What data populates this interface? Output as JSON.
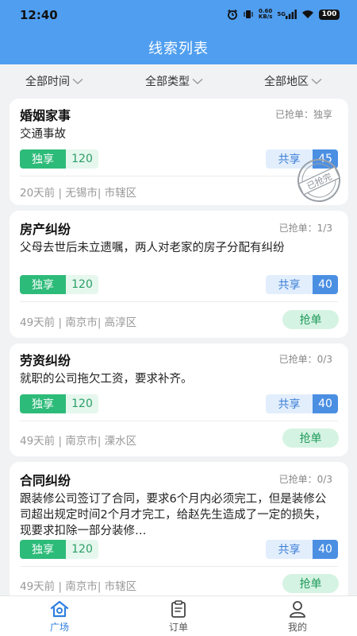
{
  "status_bar": {
    "time": "12:40",
    "speed_value": "0.60",
    "speed_unit": "KB/s",
    "network": "5G",
    "battery": "100"
  },
  "nav": {
    "title": "线索列表"
  },
  "filters": [
    {
      "label": "全部时间"
    },
    {
      "label": "全部类型"
    },
    {
      "label": "全部地区"
    }
  ],
  "labels": {
    "exclusive": "独享",
    "shared": "共享",
    "grab": "抢单",
    "stamp": "已抢完"
  },
  "leads": [
    {
      "category": "婚姻家事",
      "grab_status": "已抢单：独享",
      "description": "交通事故",
      "exclusive_price": "120",
      "shared_price": "45",
      "time_ago": "20天前",
      "city": "无锡市",
      "district": "市辖区",
      "sold_out": true
    },
    {
      "category": "房产纠纷",
      "grab_status": "已抢单：1/3",
      "description": "父母去世后未立遗嘱，两人对老家的房子分配有纠纷",
      "exclusive_price": "120",
      "shared_price": "40",
      "time_ago": "49天前",
      "city": "南京市",
      "district": "高淳区",
      "sold_out": false
    },
    {
      "category": "劳资纠纷",
      "grab_status": "已抢单：0/3",
      "description": "就职的公司拖欠工资，要求补齐。",
      "exclusive_price": "120",
      "shared_price": "40",
      "time_ago": "49天前",
      "city": "南京市",
      "district": "溧水区",
      "sold_out": false
    },
    {
      "category": "合同纠纷",
      "grab_status": "已抢单：0/3",
      "description": "跟装修公司签订了合同，要求6个月内必须完工，但是装修公司超出规定时间2个月才完工，给赵先生造成了一定的损失，现要求扣除一部分装修…",
      "exclusive_price": "120",
      "shared_price": "40",
      "time_ago": "49天前",
      "city": "南京市",
      "district": "市辖区",
      "sold_out": false
    }
  ],
  "tabbar": [
    {
      "label": "广场",
      "icon": "plaza-home-icon",
      "active": true
    },
    {
      "label": "订单",
      "icon": "clipboard-icon",
      "active": false
    },
    {
      "label": "我的",
      "icon": "user-icon",
      "active": false
    }
  ],
  "colors": {
    "header": "#4f9ef0",
    "exclusive": "#2dbb79",
    "shared": "#4b8fe3",
    "grab_button": "#d5f3e2",
    "active_tab": "#2e7fe0"
  }
}
